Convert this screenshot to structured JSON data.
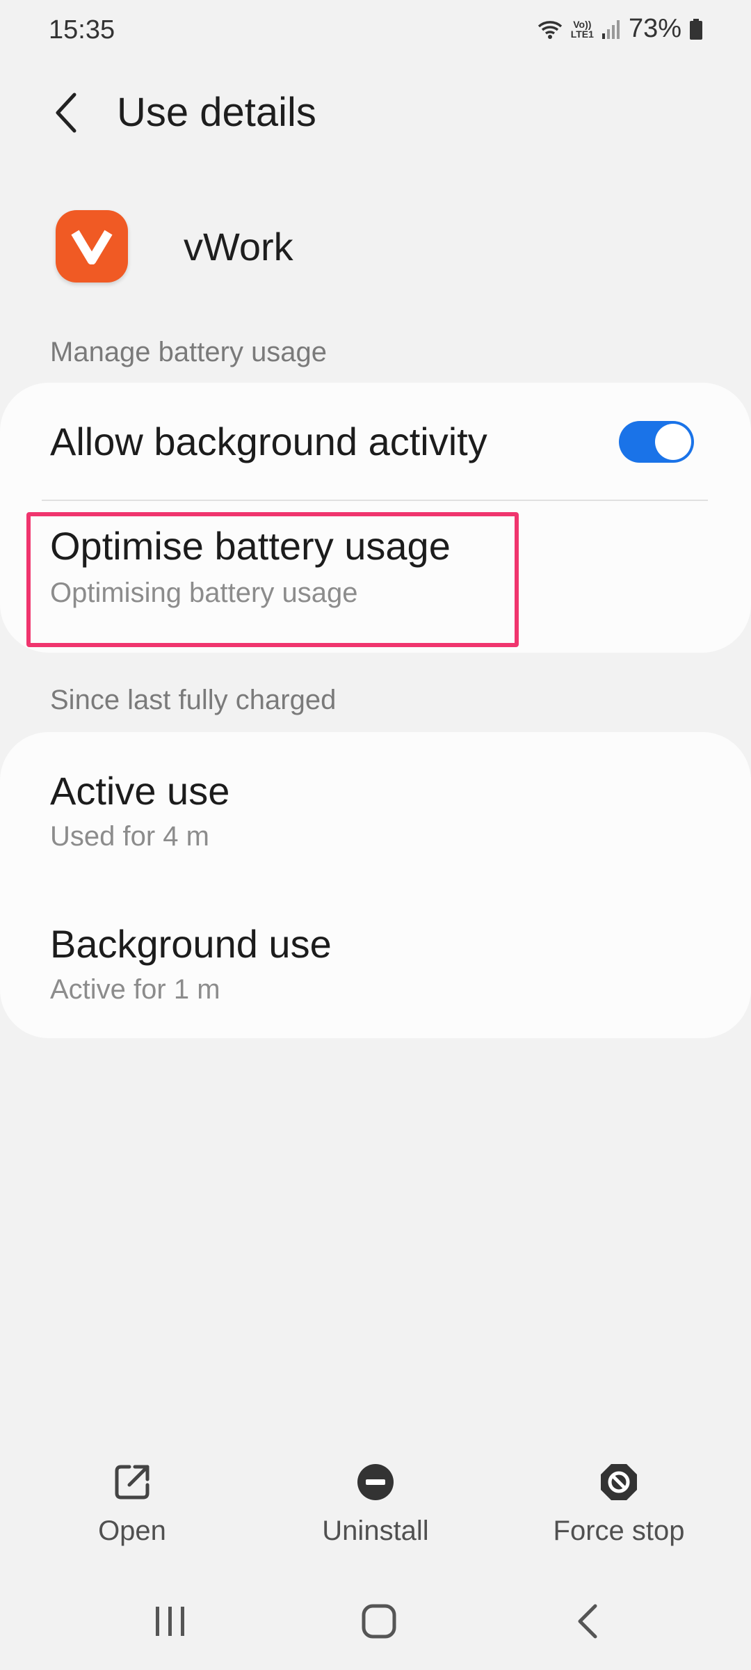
{
  "status_bar": {
    "time": "15:35",
    "battery_percent": "73%",
    "network_label_top": "Vo))",
    "network_label_bottom": "LTE1"
  },
  "header": {
    "title": "Use details"
  },
  "app": {
    "name": "vWork",
    "icon_letter": "v",
    "icon_color": "#f05a24"
  },
  "manage_section": {
    "header": "Manage battery usage",
    "allow_background": {
      "label": "Allow background activity",
      "enabled": true
    },
    "optimise": {
      "title": "Optimise battery usage",
      "subtitle": "Optimising battery usage"
    }
  },
  "usage_section": {
    "header": "Since last fully charged",
    "items": [
      {
        "title": "Active use",
        "subtitle": "Used for 4 m"
      },
      {
        "title": "Background use",
        "subtitle": "Active for 1 m"
      }
    ]
  },
  "actions": {
    "open": "Open",
    "uninstall": "Uninstall",
    "force_stop": "Force stop"
  },
  "colors": {
    "accent": "#1a73e8",
    "highlight": "#f0356e",
    "background": "#f2f2f2"
  }
}
